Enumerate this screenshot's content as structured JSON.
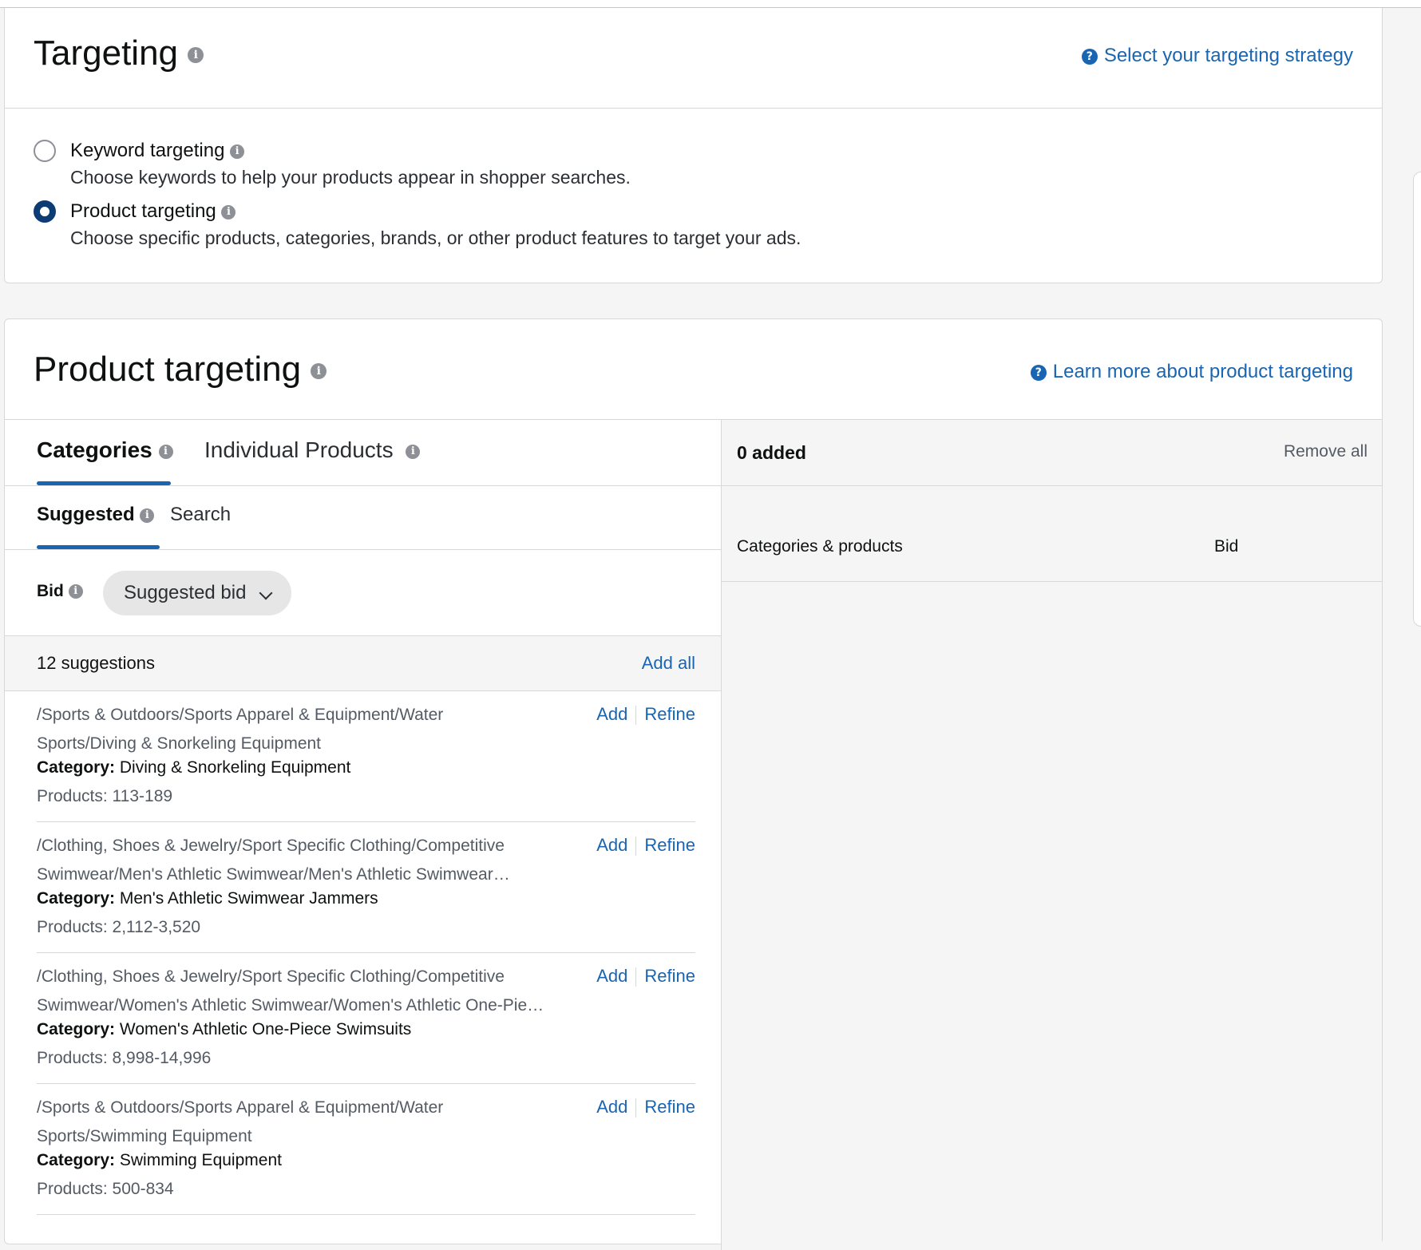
{
  "targeting": {
    "title": "Targeting",
    "help_link": "Select your targeting strategy",
    "options": [
      {
        "label": "Keyword targeting",
        "description": "Choose keywords to help your products appear in shopper searches.",
        "selected": false
      },
      {
        "label": "Product targeting",
        "description": "Choose specific products, categories, brands, or other product features to target your ads.",
        "selected": true
      }
    ]
  },
  "product_targeting": {
    "title": "Product targeting",
    "help_link": "Learn more about product targeting",
    "tabs": [
      "Categories",
      "Individual Products"
    ],
    "active_tab": "Categories",
    "subtabs": [
      "Suggested",
      "Search"
    ],
    "active_subtab": "Suggested",
    "bid_label": "Bid",
    "bid_select_value": "Suggested bid",
    "suggestions_count": "12 suggestions",
    "add_all": "Add all",
    "add_label": "Add",
    "refine_label": "Refine",
    "category_prefix": "Category:",
    "suggestions": [
      {
        "path": "/Sports & Outdoors/Sports Apparel & Equipment/Water Sports/Diving & Snorkeling Equipment",
        "category": "Diving & Snorkeling Equipment",
        "products": "Products: 113-189"
      },
      {
        "path": "/Clothing, Shoes & Jewelry/Sport Specific Clothing/Competitive Swimwear/Men's Athletic Swimwear/Men's Athletic Swimwear Jammers",
        "category": "Men's Athletic Swimwear Jammers",
        "products": "Products: 2,112-3,520"
      },
      {
        "path": "/Clothing, Shoes & Jewelry/Sport Specific Clothing/Competitive Swimwear/Women's Athletic Swimwear/Women's Athletic One-Piece Swimsuits",
        "category": "Women's Athletic One-Piece Swimsuits",
        "products": "Products: 8,998-14,996"
      },
      {
        "path": "/Sports & Outdoors/Sports Apparel & Equipment/Water Sports/Swimming Equipment",
        "category": "Swimming Equipment",
        "products": "Products: 500-834"
      }
    ],
    "added": {
      "count_label": "0 added",
      "remove_all": "Remove all",
      "col_categories": "Categories & products",
      "col_bid": "Bid"
    }
  },
  "colors": {
    "link": "#1a65b1",
    "radio_selected": "#0d3b73",
    "border": "#d5d9d9"
  }
}
